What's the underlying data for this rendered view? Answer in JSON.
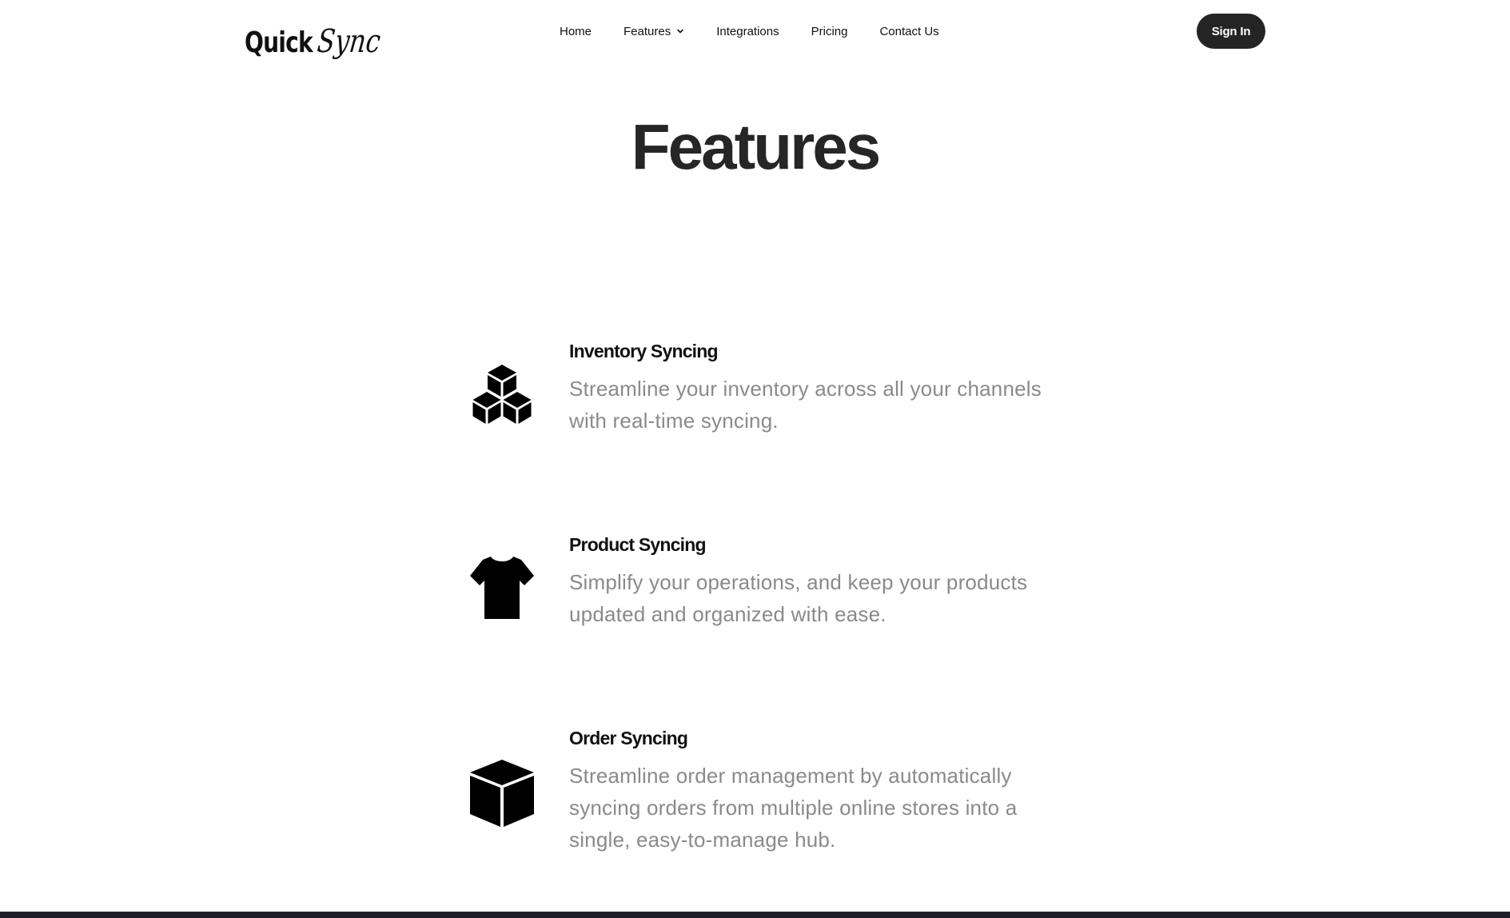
{
  "header": {
    "logo": {
      "part1": "Quick",
      "part2": "Sync"
    },
    "nav": [
      {
        "label": "Home"
      },
      {
        "label": "Features",
        "has_dropdown": true
      },
      {
        "label": "Integrations"
      },
      {
        "label": "Pricing"
      },
      {
        "label": "Contact Us"
      }
    ],
    "signin_label": "Sign In"
  },
  "main": {
    "title": "Features",
    "features": [
      {
        "icon": "cubes-icon",
        "title": "Inventory Syncing",
        "description": "Streamline your inventory across all your channels with real-time syncing."
      },
      {
        "icon": "tshirt-icon",
        "title": "Product Syncing",
        "description": "Simplify your operations, and keep your products updated and organized with ease."
      },
      {
        "icon": "box-icon",
        "title": "Order Syncing",
        "description": "Streamline order management by automatically syncing orders from multiple online stores into a single, easy-to-manage hub."
      }
    ]
  },
  "colors": {
    "text_dark": "#111111",
    "title": "#262626",
    "description": "#8a8a8a",
    "button_bg": "#242424",
    "button_text": "#ffffff",
    "footer": "#1f1e26"
  }
}
